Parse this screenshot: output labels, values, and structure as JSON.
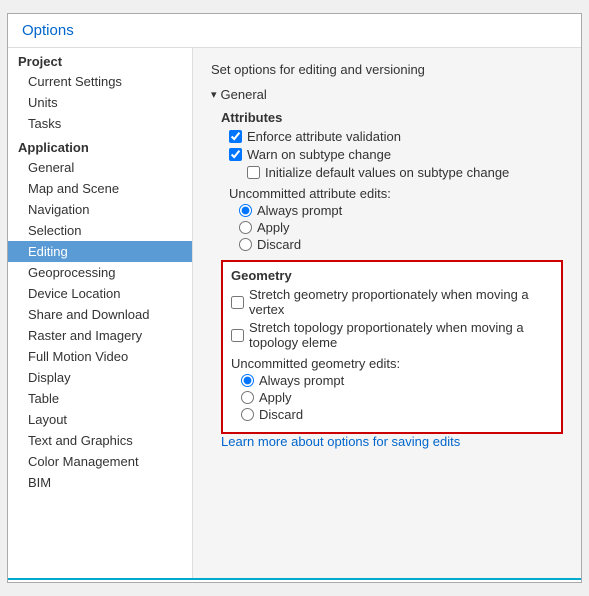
{
  "dialog": {
    "title": "Options"
  },
  "sidebar": {
    "sections": [
      {
        "header": "Project",
        "items": [
          {
            "label": "Current Settings",
            "active": false
          },
          {
            "label": "Units",
            "active": false
          },
          {
            "label": "Tasks",
            "active": false
          }
        ]
      },
      {
        "header": "Application",
        "items": [
          {
            "label": "General",
            "active": false
          },
          {
            "label": "Map and Scene",
            "active": false
          },
          {
            "label": "Navigation",
            "active": false
          },
          {
            "label": "Selection",
            "active": false
          },
          {
            "label": "Editing",
            "active": true
          },
          {
            "label": "Geoprocessing",
            "active": false
          },
          {
            "label": "Device Location",
            "active": false
          },
          {
            "label": "Share and Download",
            "active": false
          },
          {
            "label": "Raster and Imagery",
            "active": false
          },
          {
            "label": "Full Motion Video",
            "active": false
          },
          {
            "label": "Display",
            "active": false
          },
          {
            "label": "Table",
            "active": false
          },
          {
            "label": "Layout",
            "active": false
          },
          {
            "label": "Text and Graphics",
            "active": false
          },
          {
            "label": "Color Management",
            "active": false
          },
          {
            "label": "BIM",
            "active": false
          }
        ]
      }
    ]
  },
  "content": {
    "title": "Set options for editing and versioning",
    "general_section": "General",
    "attributes_label": "Attributes",
    "enforce_validation": "Enforce attribute validation",
    "warn_on_subtype": "Warn on subtype change",
    "init_default_values": "Initialize default values on subtype change",
    "uncommitted_attr_label": "Uncommitted attribute edits:",
    "attr_radio": {
      "always_prompt": "Always prompt",
      "apply": "Apply",
      "discard": "Discard"
    },
    "geometry_section": "Geometry",
    "stretch_proportionate": "Stretch geometry proportionately when moving a vertex",
    "stretch_topology": "Stretch topology proportionately when moving a topology eleme",
    "uncommitted_geo_label": "Uncommitted geometry edits:",
    "geo_radio": {
      "always_prompt": "Always prompt",
      "apply": "Apply",
      "discard": "Discard"
    },
    "learn_more": "Learn more about options for saving edits"
  }
}
